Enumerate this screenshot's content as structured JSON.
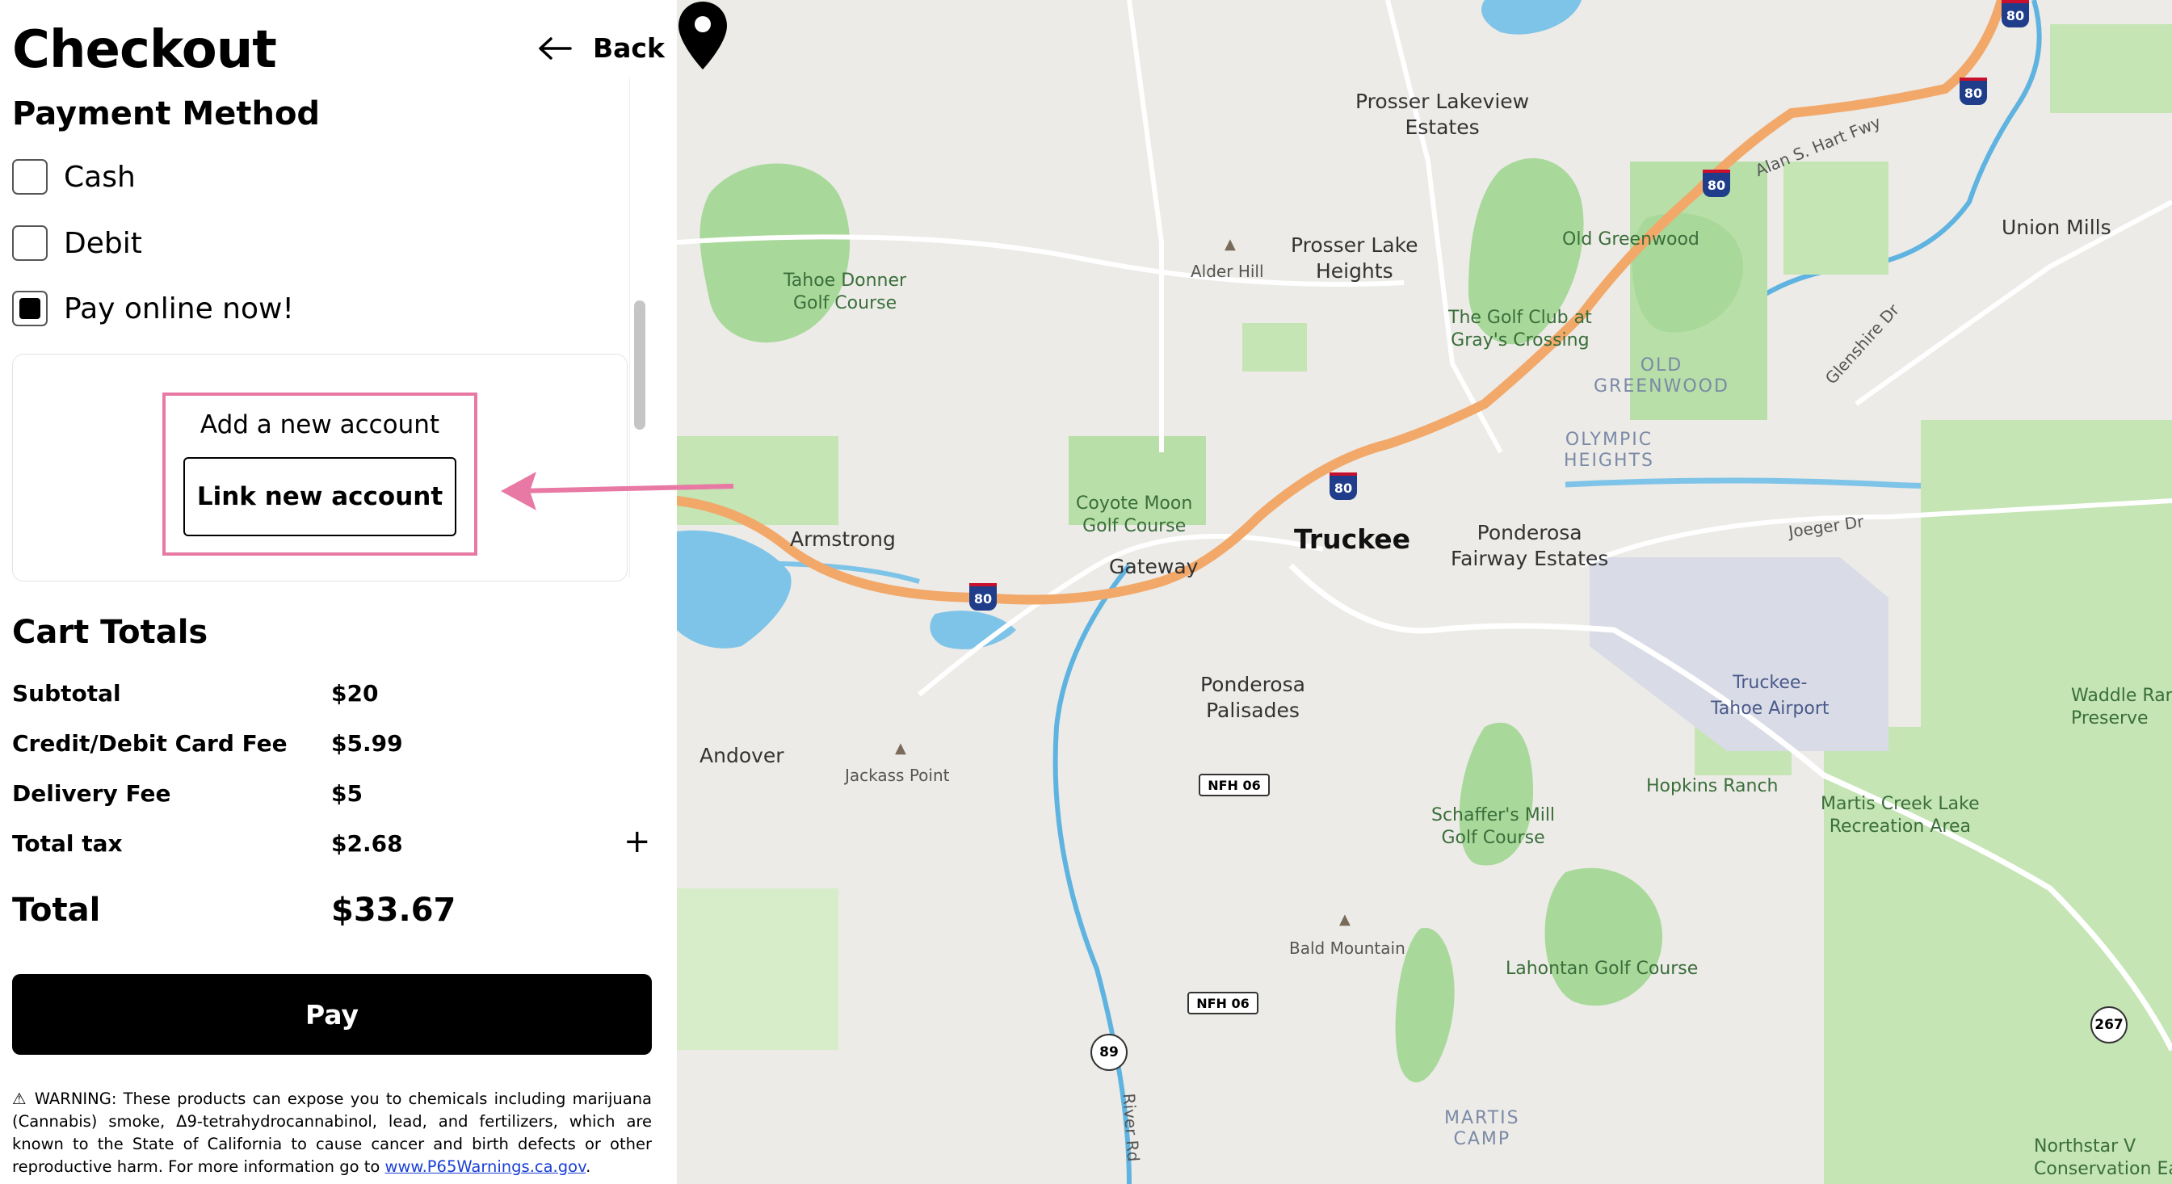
{
  "checkout": {
    "title": "Checkout",
    "back_label": "Back",
    "payment_method": {
      "heading": "Payment Method",
      "options": [
        {
          "label": "Cash",
          "checked": false
        },
        {
          "label": "Debit",
          "checked": false
        },
        {
          "label": "Pay online now!",
          "checked": true
        }
      ],
      "add_account_label": "Add a new account",
      "link_account_button": "Link new account"
    },
    "cart": {
      "heading": "Cart Totals",
      "rows": [
        {
          "label": "Subtotal",
          "value": "$20"
        },
        {
          "label": "Credit/Debit Card Fee",
          "value": "$5.99"
        },
        {
          "label": "Delivery Fee",
          "value": "$5"
        },
        {
          "label": "Total tax",
          "value": "$2.68"
        }
      ],
      "expand_symbol": "+",
      "total_label": "Total",
      "total_value": "$33.67"
    },
    "pay_button": "Pay",
    "warning": {
      "text": "⚠ WARNING: These products can expose you to chemicals including marijuana (Cannabis) smoke, Δ9-tetrahydrocannabinol, lead, and fertilizers, which are known to the State of California to cause cancer and birth defects or other reproductive harm. For more information go to ",
      "link_text": "www.P65Warnings.ca.gov",
      "suffix": "."
    }
  },
  "annotation": {
    "highlight_color": "#e879a4",
    "arrow_color": "#e879a4"
  },
  "map": {
    "labels": {
      "prosser_lakeview": "Prosser Lakeview\nEstates",
      "prosser_lake_heights": "Prosser Lake\nHeights",
      "alder_hill": "Alder Hill",
      "tahoe_donner": "Tahoe Donner\nGolf Course",
      "old_greenwood": "Old Greenwood",
      "golf_club_grays": "The Golf Club at\nGray's Crossing",
      "old_greenwood_area": "OLD\nGREENWOOD",
      "olympic_heights": "OLYMPIC\nHEIGHTS",
      "union_mills": "Union Mills",
      "glenshire_dr": "Glenshire Dr",
      "alan_hart_fwy": "Alan S. Hart Fwy",
      "coyote_moon": "Coyote Moon\nGolf Course",
      "armstrong": "Armstrong",
      "gateway": "Gateway",
      "truckee": "Truckee",
      "ponderosa_fairway": "Ponderosa\nFairway Estates",
      "joeger_dr": "Joeger Dr",
      "ponderosa_palisades": "Ponderosa\nPalisades",
      "truckee_tahoe_airport": "Truckee-\nTahoe Airport",
      "andover": "Andover",
      "jackass_point": "Jackass Point",
      "hopkins_ranch": "Hopkins Ranch",
      "martis_creek": "Martis Creek Lake\nRecreation Area",
      "waddle_ranch": "Waddle Ranc\nPreserve",
      "schaffers_mill": "Schaffer's Mill\nGolf Course",
      "bald_mountain": "Bald Mountain",
      "lahontan": "Lahontan Golf Course",
      "martis_camp": "MARTIS\nCAMP",
      "northstar": "Northstar V\nConservation Eas",
      "river_rd": "River Rd",
      "nfh_06": "NFH 06",
      "i80": "80",
      "route_89": "89",
      "route_267": "267"
    },
    "colors": {
      "land": "#ecebe7",
      "park": "#a8d89a",
      "water": "#7ec3e8",
      "highway": "#f2a869",
      "road": "#ffffff",
      "airport": "#d9dce6"
    }
  }
}
